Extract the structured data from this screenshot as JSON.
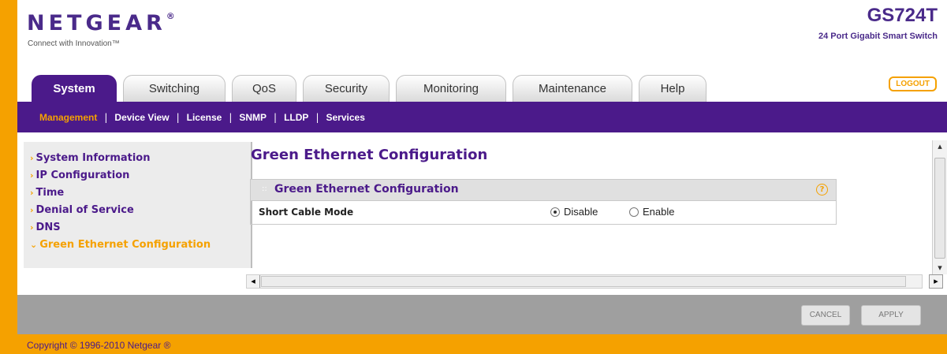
{
  "brand": {
    "logo": "NETGEAR",
    "registered": "®",
    "tagline": "Connect with Innovation™",
    "model": "GS724T",
    "model_subtitle": "24 Port Gigabit Smart Switch"
  },
  "tabs": [
    {
      "label": "System",
      "active": true
    },
    {
      "label": "Switching",
      "active": false
    },
    {
      "label": "QoS",
      "active": false
    },
    {
      "label": "Security",
      "active": false
    },
    {
      "label": "Monitoring",
      "active": false
    },
    {
      "label": "Maintenance",
      "active": false
    },
    {
      "label": "Help",
      "active": false
    }
  ],
  "logout_label": "LOGOUT",
  "subnav": [
    {
      "label": "Management",
      "active": true
    },
    {
      "label": "Device View",
      "active": false
    },
    {
      "label": "License",
      "active": false
    },
    {
      "label": "SNMP",
      "active": false
    },
    {
      "label": "LLDP",
      "active": false
    },
    {
      "label": "Services",
      "active": false
    }
  ],
  "sidebar": [
    {
      "label": "System Information",
      "active": false
    },
    {
      "label": "IP Configuration",
      "active": false
    },
    {
      "label": "Time",
      "active": false
    },
    {
      "label": "Denial of Service",
      "active": false
    },
    {
      "label": "DNS",
      "active": false
    },
    {
      "label": "Green Ethernet Configuration",
      "active": true
    }
  ],
  "page_title": "Green Ethernet Configuration",
  "panel": {
    "title": "Green Ethernet Configuration",
    "row_label": "Short Cable Mode",
    "options": [
      {
        "label": "Disable",
        "checked": true
      },
      {
        "label": "Enable",
        "checked": false
      }
    ]
  },
  "buttons": {
    "cancel": "CANCEL",
    "apply": "APPLY"
  },
  "copyright": "Copyright © 1996-2010 Netgear ®",
  "colors": {
    "brand_purple": "#4b1a8a",
    "brand_orange": "#f5a100"
  }
}
